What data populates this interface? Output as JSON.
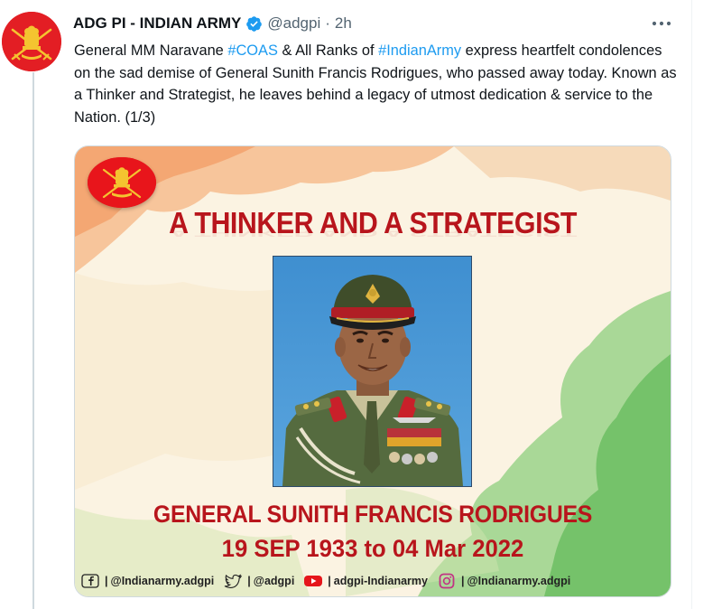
{
  "tweet": {
    "author_name": "ADG PI - INDIAN ARMY",
    "handle": "@adgpi",
    "dot": "·",
    "time": "2h",
    "text_parts": [
      "General MM Naravane ",
      "#COAS",
      " & All Ranks of ",
      "#IndianArmy",
      " express heartfelt condolences on the sad demise of General Sunith Francis Rodrigues, who passed away today. Known as a Thinker and Strategist, he leaves behind a legacy of utmost dedication & service to the Nation. (1/3)"
    ]
  },
  "icons": {
    "verified": "verified-badge-icon",
    "more": "more-options-icon",
    "avatar": "indian-army-emblem",
    "facebook": "facebook-icon",
    "twitter": "twitter-icon",
    "youtube": "youtube-icon",
    "instagram": "instagram-icon"
  },
  "colors": {
    "link": "#1d9bf0",
    "verified": "#1d9bf0",
    "banner_red": "#b8151c",
    "army_red": "#e31e24"
  },
  "media": {
    "title": "A THINKER AND A STRATEGIST",
    "person_name": "GENERAL SUNITH FRANCIS RODRIGUES",
    "dates": "19 SEP 1933 to  04 Mar 2022",
    "social": {
      "facebook": "@Indianarmy.adgpi",
      "twitter": "@adgpi",
      "youtube": "adgpi-Indianarmy",
      "instagram": "@Indianarmy.adgpi",
      "separator": "|"
    }
  }
}
